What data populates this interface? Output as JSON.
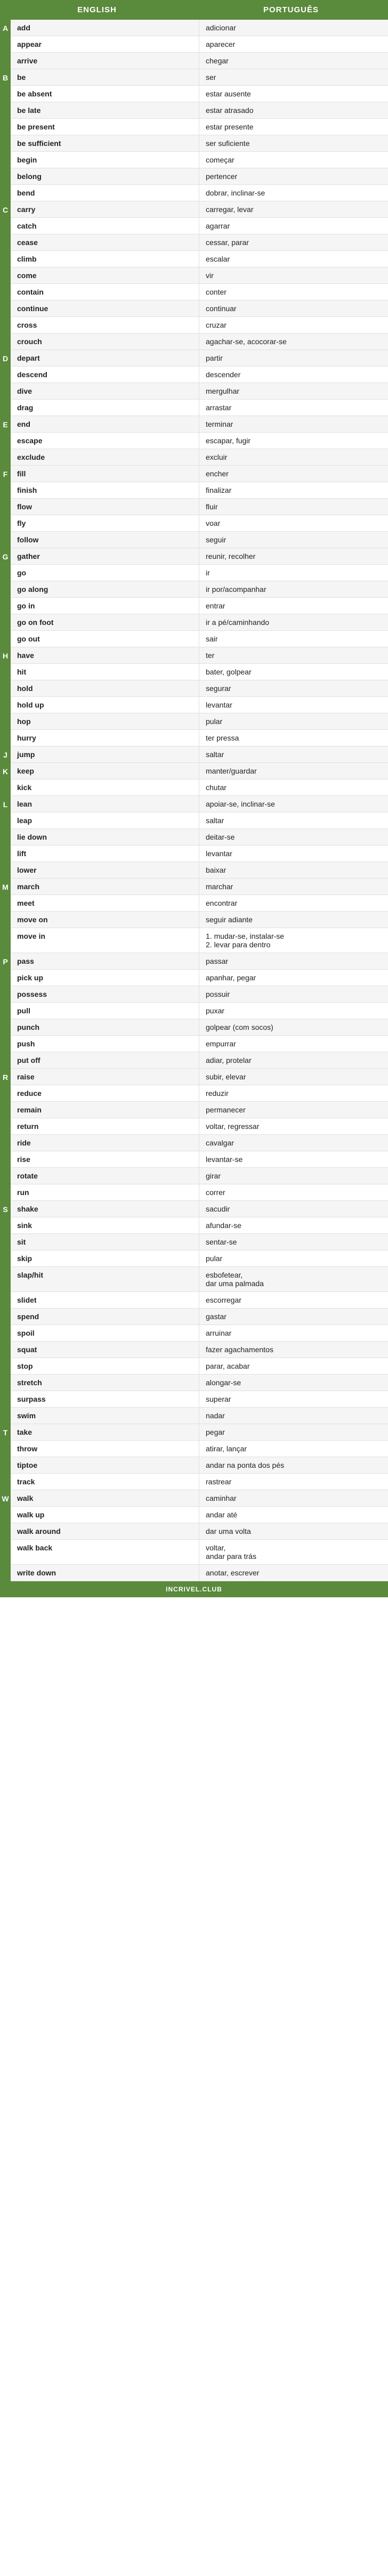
{
  "header": {
    "col_en": "ENGLISH",
    "col_pt": "PORTUGUÊS"
  },
  "footer": {
    "label": "INCRIVEL.CLUB"
  },
  "sections": [
    {
      "letter": "A",
      "rows": [
        {
          "en": "add",
          "pt": "adicionar"
        },
        {
          "en": "appear",
          "pt": "aparecer"
        },
        {
          "en": "arrive",
          "pt": "chegar"
        }
      ]
    },
    {
      "letter": "B",
      "rows": [
        {
          "en": "be",
          "pt": "ser"
        },
        {
          "en": "be absent",
          "pt": "estar ausente"
        },
        {
          "en": "be late",
          "pt": "estar atrasado"
        },
        {
          "en": "be present",
          "pt": "estar presente"
        },
        {
          "en": "be sufficient",
          "pt": "ser suficiente"
        },
        {
          "en": "begin",
          "pt": "começar"
        },
        {
          "en": "belong",
          "pt": "pertencer"
        },
        {
          "en": "bend",
          "pt": "dobrar, inclinar-se"
        }
      ]
    },
    {
      "letter": "C",
      "rows": [
        {
          "en": "carry",
          "pt": "carregar, levar"
        },
        {
          "en": "catch",
          "pt": "agarrar"
        },
        {
          "en": "cease",
          "pt": "cessar, parar"
        },
        {
          "en": "climb",
          "pt": "escalar"
        },
        {
          "en": "come",
          "pt": "vir"
        },
        {
          "en": "contain",
          "pt": "conter"
        },
        {
          "en": "continue",
          "pt": "continuar"
        },
        {
          "en": "cross",
          "pt": "cruzar"
        },
        {
          "en": "crouch",
          "pt": "agachar-se, acocorar-se"
        }
      ]
    },
    {
      "letter": "D",
      "rows": [
        {
          "en": "depart",
          "pt": "partir"
        },
        {
          "en": "descend",
          "pt": "descender"
        },
        {
          "en": "dive",
          "pt": "mergulhar"
        },
        {
          "en": "drag",
          "pt": "arrastar"
        }
      ]
    },
    {
      "letter": "E",
      "rows": [
        {
          "en": "end",
          "pt": "terminar"
        },
        {
          "en": "escape",
          "pt": "escapar, fugir"
        },
        {
          "en": "exclude",
          "pt": "excluir"
        }
      ]
    },
    {
      "letter": "F",
      "rows": [
        {
          "en": "fill",
          "pt": "encher"
        },
        {
          "en": "finish",
          "pt": "finalizar"
        },
        {
          "en": "flow",
          "pt": "fluir"
        },
        {
          "en": "fly",
          "pt": "voar"
        },
        {
          "en": "follow",
          "pt": "seguir"
        }
      ]
    },
    {
      "letter": "G",
      "rows": [
        {
          "en": "gather",
          "pt": "reunir, recolher"
        },
        {
          "en": "go",
          "pt": "ir"
        },
        {
          "en": "go along",
          "pt": "ir por/acompanhar"
        },
        {
          "en": "go in",
          "pt": "entrar"
        },
        {
          "en": "go on foot",
          "pt": "ir a pé/caminhando"
        },
        {
          "en": "go out",
          "pt": "sair"
        }
      ]
    },
    {
      "letter": "H",
      "rows": [
        {
          "en": "have",
          "pt": "ter"
        },
        {
          "en": "hit",
          "pt": "bater, golpear"
        },
        {
          "en": "hold",
          "pt": "segurar"
        },
        {
          "en": "hold up",
          "pt": "levantar"
        },
        {
          "en": "hop",
          "pt": "pular"
        },
        {
          "en": "hurry",
          "pt": "ter pressa"
        }
      ]
    },
    {
      "letter": "J",
      "rows": [
        {
          "en": "jump",
          "pt": "saltar"
        }
      ]
    },
    {
      "letter": "K",
      "rows": [
        {
          "en": "keep",
          "pt": "manter/guardar"
        },
        {
          "en": "kick",
          "pt": "chutar"
        }
      ]
    },
    {
      "letter": "L",
      "rows": [
        {
          "en": "lean",
          "pt": "apoiar-se, inclinar-se"
        },
        {
          "en": "leap",
          "pt": "saltar"
        },
        {
          "en": "lie down",
          "pt": "deitar-se"
        },
        {
          "en": "lift",
          "pt": "levantar"
        },
        {
          "en": "lower",
          "pt": "baixar"
        }
      ]
    },
    {
      "letter": "M",
      "rows": [
        {
          "en": "march",
          "pt": "marchar"
        },
        {
          "en": "meet",
          "pt": "encontrar"
        },
        {
          "en": "move on",
          "pt": "seguir adiante"
        },
        {
          "en": "move in",
          "pt": "1. mudar-se, instalar-se\n2. levar para dentro"
        }
      ]
    },
    {
      "letter": "P",
      "rows": [
        {
          "en": "pass",
          "pt": "passar"
        },
        {
          "en": "pick up",
          "pt": "apanhar, pegar"
        },
        {
          "en": "possess",
          "pt": "possuir"
        },
        {
          "en": "pull",
          "pt": "puxar"
        },
        {
          "en": "punch",
          "pt": "golpear (com socos)"
        },
        {
          "en": "push",
          "pt": "empurrar"
        },
        {
          "en": "put off",
          "pt": "adiar, protelar"
        }
      ]
    },
    {
      "letter": "R",
      "rows": [
        {
          "en": "raise",
          "pt": "subir, elevar"
        },
        {
          "en": "reduce",
          "pt": "reduzir"
        },
        {
          "en": "remain",
          "pt": "permanecer"
        },
        {
          "en": "return",
          "pt": "voltar, regressar"
        },
        {
          "en": "ride",
          "pt": "cavalgar"
        },
        {
          "en": "rise",
          "pt": "levantar-se"
        },
        {
          "en": "rotate",
          "pt": "girar"
        },
        {
          "en": "run",
          "pt": "correr"
        }
      ]
    },
    {
      "letter": "S",
      "rows": [
        {
          "en": "shake",
          "pt": "sacudir"
        },
        {
          "en": "sink",
          "pt": "afundar-se"
        },
        {
          "en": "sit",
          "pt": "sentar-se"
        },
        {
          "en": "skip",
          "pt": "pular"
        },
        {
          "en": "slap/hit",
          "pt": "esbofetear,\ndar uma palmada"
        },
        {
          "en": "slidet",
          "pt": "escorregar"
        },
        {
          "en": "spend",
          "pt": "gastar"
        },
        {
          "en": "spoil",
          "pt": "arruinar"
        },
        {
          "en": "squat",
          "pt": "fazer agachamentos"
        },
        {
          "en": "stop",
          "pt": "parar, acabar"
        },
        {
          "en": "stretch",
          "pt": "alongar-se"
        },
        {
          "en": "surpass",
          "pt": "superar"
        },
        {
          "en": "swim",
          "pt": "nadar"
        }
      ]
    },
    {
      "letter": "T",
      "rows": [
        {
          "en": "take",
          "pt": "pegar"
        },
        {
          "en": "throw",
          "pt": "atirar, lançar"
        },
        {
          "en": "tiptoe",
          "pt": "andar na ponta dos pés"
        },
        {
          "en": "track",
          "pt": "rastrear"
        }
      ]
    },
    {
      "letter": "W",
      "rows": [
        {
          "en": "walk",
          "pt": "caminhar"
        },
        {
          "en": "walk up",
          "pt": "andar até"
        },
        {
          "en": "walk around",
          "pt": "dar uma volta"
        },
        {
          "en": "walk back",
          "pt": "voltar,\nandar para trás"
        },
        {
          "en": "write down",
          "pt": "anotar, escrever"
        }
      ]
    }
  ]
}
